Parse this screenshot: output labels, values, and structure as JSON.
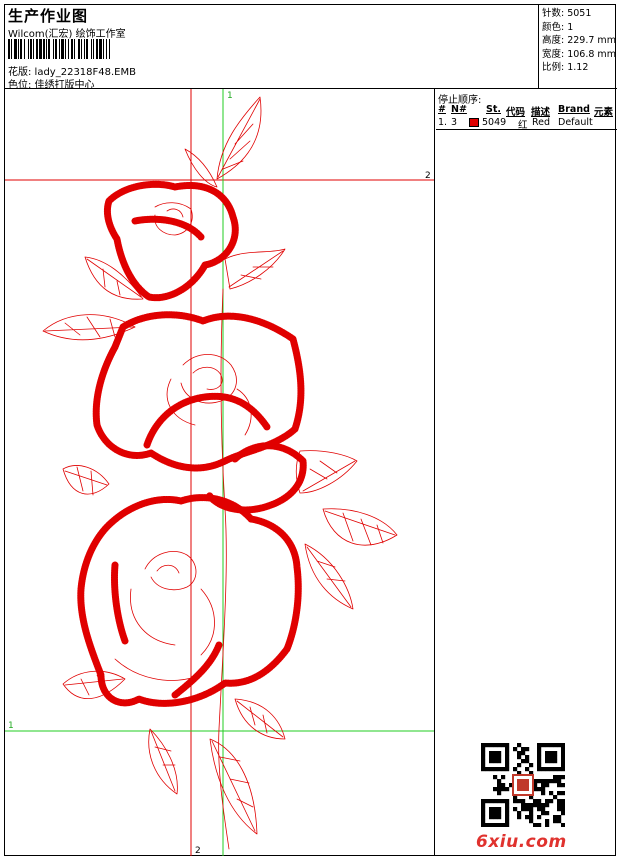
{
  "header": {
    "title": "生产作业图",
    "company": "Wilcom(汇宏) 绘饰工作室",
    "design_file": "花版: lady_22318F48.EMB",
    "colorway": "色位: 佳绣打版中心"
  },
  "info": {
    "stitches": "针数: 5051",
    "colors": "颜色: 1",
    "height": "高度: 229.7 mm",
    "width": "宽度: 106.8 mm",
    "scale": "比例: 1.12"
  },
  "guides": {
    "vertical_1": "1",
    "horizontal_2": "2",
    "horizontal_1": "1",
    "vertical_2": "2"
  },
  "stop_sequence": {
    "title": "停止顺序:",
    "columns": [
      "#",
      "N#",
      "St.",
      "代码",
      "描述",
      "Brand",
      "元素"
    ],
    "rows": [
      {
        "num": "1.",
        "needle": "3",
        "stitches": "5049",
        "code": "红",
        "description": "Red",
        "brand": "Default",
        "element": "",
        "swatch_color": "#e00000"
      }
    ]
  },
  "watermark": {
    "site": "6xiu.com"
  },
  "colors": {
    "thread": "#e00000",
    "guide_red": "#e00000",
    "guide_green": "#22cc22"
  }
}
